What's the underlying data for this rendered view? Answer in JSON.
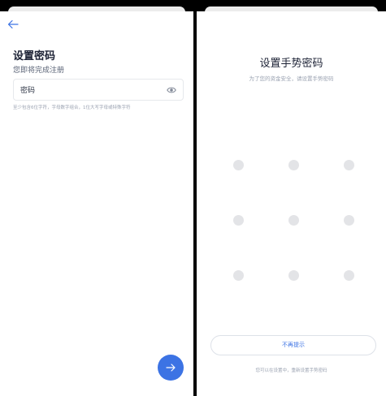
{
  "register": {
    "title": "设置密码",
    "subtitle": "您即将完成注册",
    "password_placeholder": "密码",
    "hint": "至少包含6位字符，字母数字组合，1位大写字母或特殊字符",
    "next_icon": "arrow-right-icon",
    "back_icon": "arrow-left-icon",
    "visibility_icon": "eye-icon",
    "accent_color": "#3c73e4"
  },
  "gesture": {
    "title": "设置手势密码",
    "subtitle": "为了您的资金安全，请设置手势密码",
    "dots": [
      1,
      2,
      3,
      4,
      5,
      6,
      7,
      8,
      9
    ],
    "skip_label": "不再提示",
    "note": "您可以在设置中，重新设置手势密码"
  }
}
